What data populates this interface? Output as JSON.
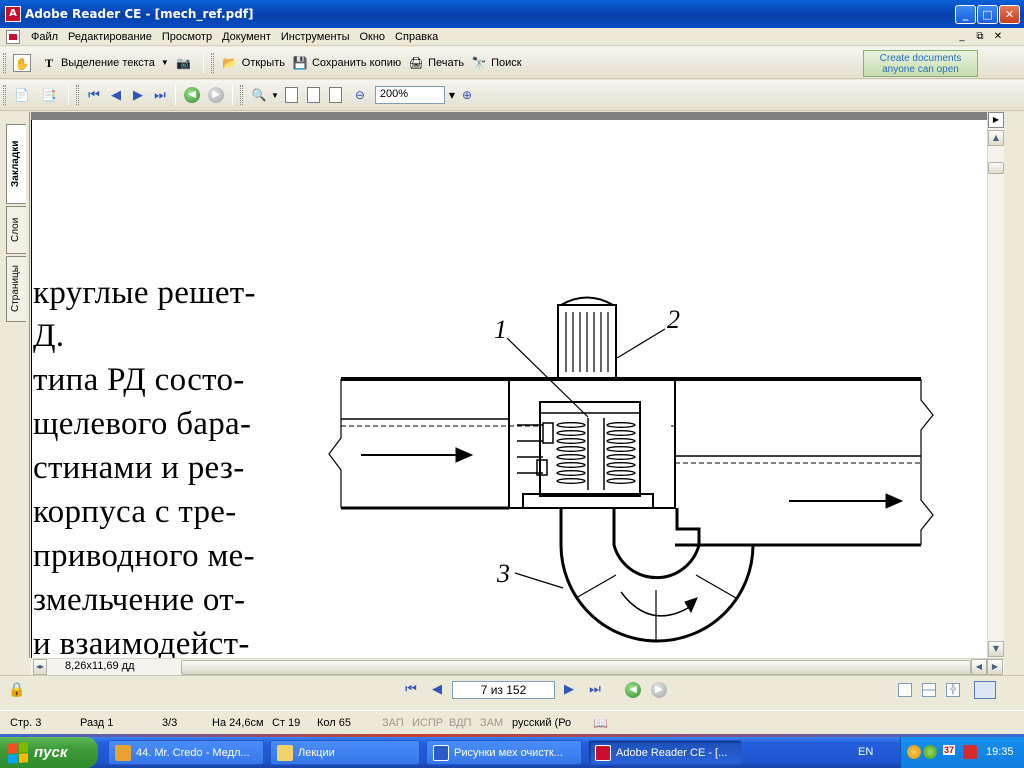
{
  "window": {
    "title": "Adobe Reader CE - [mech_ref.pdf]",
    "min": "_",
    "max": "□",
    "close": "✕"
  },
  "menu": {
    "items": [
      "Файл",
      "Редактирование",
      "Просмотр",
      "Документ",
      "Инструменты",
      "Окно",
      "Справка"
    ]
  },
  "toolbar1": {
    "select_text": "Выделение текста",
    "open": "Открыть",
    "save_copy": "Сохранить копию",
    "print": "Печать",
    "search": "Поиск"
  },
  "toolbar2": {
    "zoom": "200%"
  },
  "promo": {
    "line1": "Create documents",
    "line2": "anyone can open"
  },
  "lefttabs": [
    "Закладки",
    "Слои",
    "Страницы"
  ],
  "document": {
    "lines": [
      "круглые решет-",
      "Д.",
      "типа РД состо-",
      "щелевого бара-",
      "стинами и рез-",
      "корпуса с тре-",
      "приводного ме-",
      "змельчение от-",
      "и взаимодейст-"
    ],
    "fig_labels": [
      "1",
      "2",
      "3"
    ]
  },
  "hscroll": {
    "page_size": "8,26x11,69 дд"
  },
  "bottomnav": {
    "page": "7 из 152"
  },
  "wordstatus": {
    "page": "Стр. 3",
    "section": "Разд 1",
    "pages": "3/3",
    "at": "На 24,6см",
    "line": "Ст 19",
    "col": "Кол 65",
    "rec": "ЗАП",
    "trk": "ИСПР",
    "ext": "ВДП",
    "ovr": "ЗАМ",
    "lang": "русский (Ро"
  },
  "taskbar": {
    "start": "пуск",
    "tasks": [
      "44. Mr. Credo - Медл...",
      "Лекции",
      "Рисунки мех очистк...",
      "Adobe Reader CE - [..."
    ],
    "lang": "EN",
    "tray_num": "37",
    "time": "19:35"
  }
}
